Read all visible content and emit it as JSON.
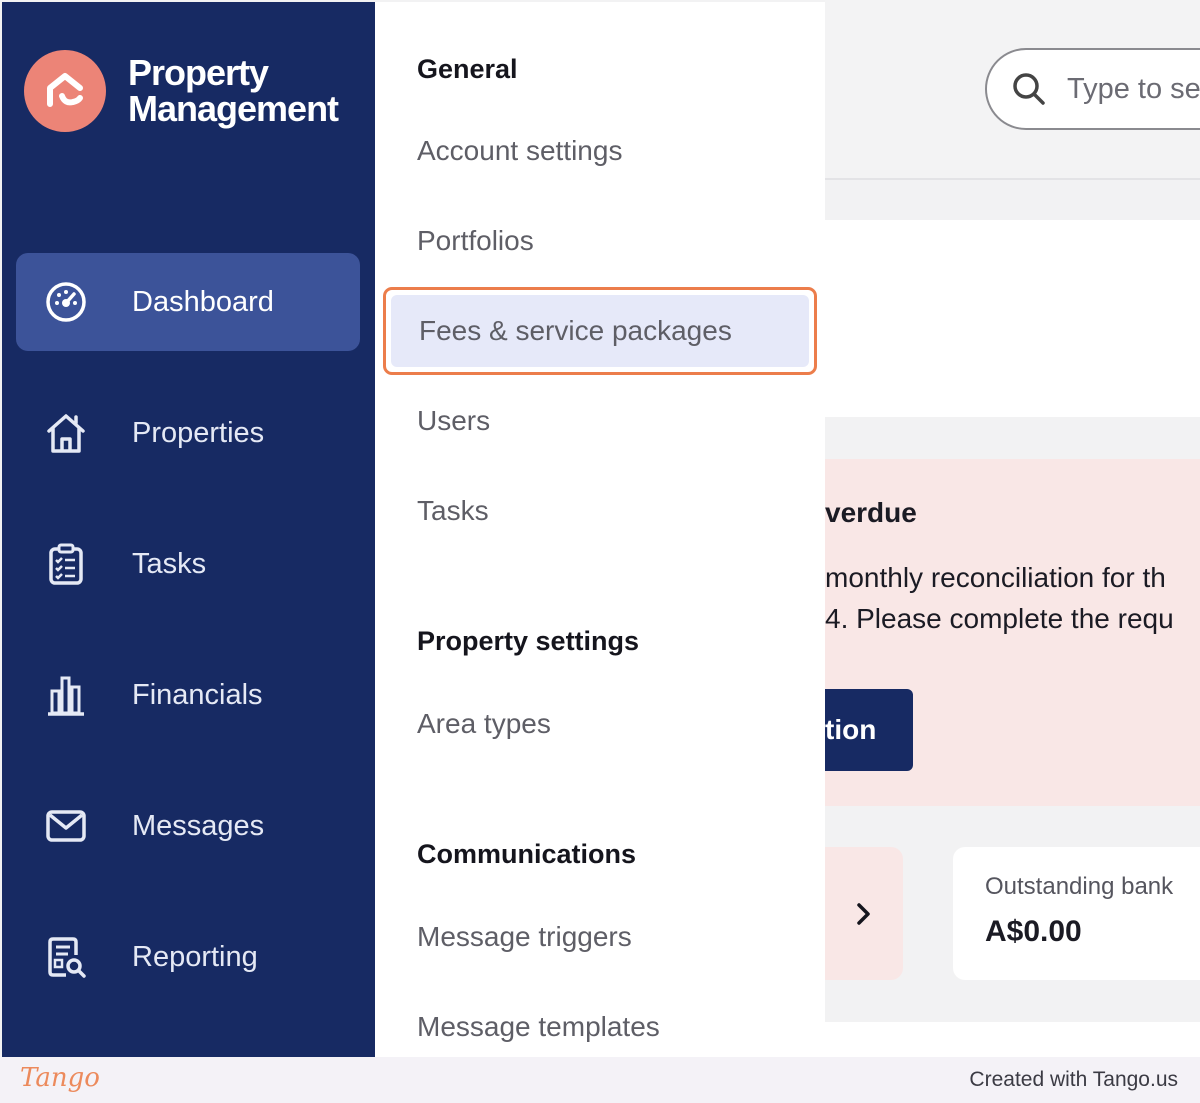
{
  "app": {
    "title": "Property Management",
    "logo_line1": "Property",
    "logo_line2": "Management",
    "brand_color": "#ec8477"
  },
  "sidebar": {
    "items": [
      {
        "label": "Dashboard",
        "icon": "dashboard-gauge-icon",
        "active": true
      },
      {
        "label": "Properties",
        "icon": "house-icon",
        "active": false
      },
      {
        "label": "Tasks",
        "icon": "clipboard-checklist-icon",
        "active": false
      },
      {
        "label": "Financials",
        "icon": "bar-chart-icon",
        "active": false
      },
      {
        "label": "Messages",
        "icon": "envelope-icon",
        "active": false
      },
      {
        "label": "Reporting",
        "icon": "report-search-icon",
        "active": false
      }
    ]
  },
  "menu": {
    "general_heading": "General",
    "general_items": [
      "Account settings",
      "Portfolios",
      "Fees & service packages",
      "Users",
      "Tasks"
    ],
    "highlighted_item": "Fees & service packages",
    "property_heading": "Property settings",
    "property_items": [
      "Area types"
    ],
    "communications_heading": "Communications",
    "communications_items": [
      "Message triggers",
      "Message templates"
    ],
    "highlight_color": "#ec7d4b"
  },
  "search": {
    "placeholder": "Type to se"
  },
  "alert": {
    "title": "verdue",
    "line1": "monthly reconciliation for th",
    "line2": "4. Please complete the requ",
    "button_label": "tion"
  },
  "stat": {
    "label": "Outstanding bank",
    "value": "A$0.00"
  },
  "footer": {
    "logo": "Tango",
    "text": "Created with Tango.us"
  }
}
